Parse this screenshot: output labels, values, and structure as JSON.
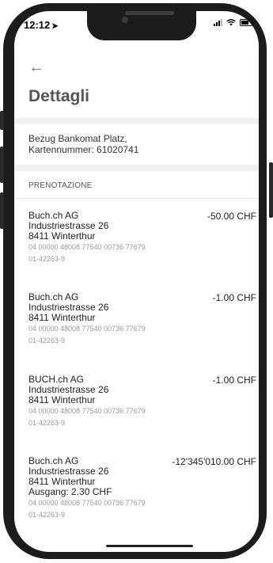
{
  "status": {
    "time": "12:12"
  },
  "header": {
    "title": "Dettagli"
  },
  "description": {
    "line1": "Bezug Bankomat Platz,",
    "line2": "Kartennummer: 61020741"
  },
  "section": {
    "title": "PRENOTAZIONE"
  },
  "transactions": [
    {
      "name": "Buch.ch AG",
      "street": "Industriestrasse 26",
      "city": "8411 Winterthur",
      "amount": "-50.00 CHF",
      "ref1": "04 00000 48008 77540 00736 77679",
      "ref2": "01-42263-9"
    },
    {
      "name": "Buch.ch AG",
      "street": "Industriestrasse 26",
      "city": "8411 Winterthur",
      "amount": "-1.00 CHF",
      "ref1": "04 00000 48008 77540 00736 77679",
      "ref2": "01-42263-9"
    },
    {
      "name": "BUCH.ch AG",
      "street": "Industriestrasse 26",
      "city": "8411 Winterthur",
      "amount": "-1.00 CHF",
      "ref1": "04 00000 48008 77540 00736 77679",
      "ref2": "01-42263-9"
    },
    {
      "name": "Buch.ch AG",
      "street": "Industriestrasse 26",
      "city": "8411 Winterthur",
      "extra": "Ausgang: 2.30 CHF",
      "amount": "-12'345'010.00 CHF",
      "ref1": "04 00000 48008 77540 00736 77679",
      "ref2": "01-42263-9"
    }
  ]
}
